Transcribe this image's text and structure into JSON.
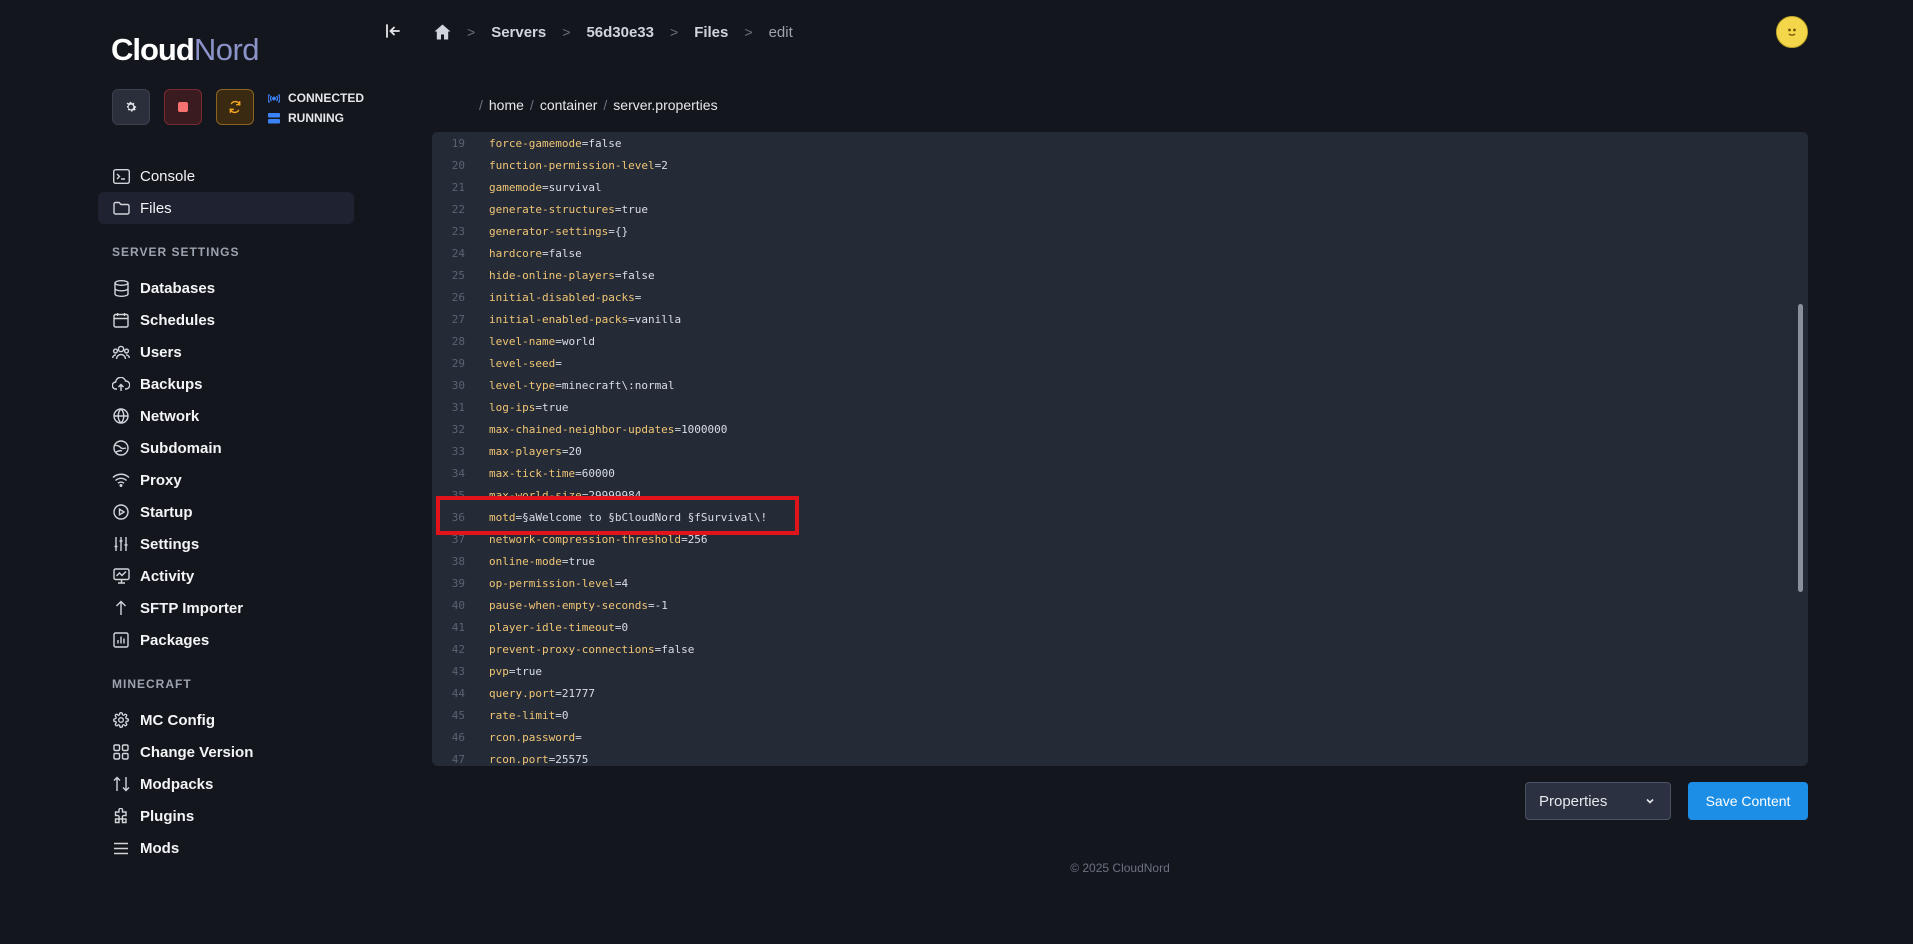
{
  "brand": {
    "part1": "Cloud",
    "part2": "Nord"
  },
  "server_status": {
    "connection": "CONNECTED",
    "state": "RUNNING"
  },
  "nav": {
    "main": [
      {
        "label": "Console",
        "icon": "terminal-icon"
      },
      {
        "label": "Files",
        "icon": "folder-icon",
        "active": true
      }
    ],
    "server_settings_title": "SERVER SETTINGS",
    "server_settings": [
      {
        "label": "Databases",
        "icon": "database-icon"
      },
      {
        "label": "Schedules",
        "icon": "calendar-icon"
      },
      {
        "label": "Users",
        "icon": "users-icon"
      },
      {
        "label": "Backups",
        "icon": "cloud-upload-icon"
      },
      {
        "label": "Network",
        "icon": "globe-icon"
      },
      {
        "label": "Subdomain",
        "icon": "subdomain-globe-icon"
      },
      {
        "label": "Proxy",
        "icon": "wifi-icon"
      },
      {
        "label": "Startup",
        "icon": "play-circle-icon"
      },
      {
        "label": "Settings",
        "icon": "sliders-icon"
      },
      {
        "label": "Activity",
        "icon": "activity-icon"
      },
      {
        "label": "SFTP Importer",
        "icon": "arrow-up-icon"
      },
      {
        "label": "Packages",
        "icon": "bar-chart-icon"
      }
    ],
    "minecraft_title": "MINECRAFT",
    "minecraft": [
      {
        "label": "MC Config",
        "icon": "gear-icon"
      },
      {
        "label": "Change Version",
        "icon": "grid-icon"
      },
      {
        "label": "Modpacks",
        "icon": "arrows-up-down-icon"
      },
      {
        "label": "Plugins",
        "icon": "puzzle-icon"
      },
      {
        "label": "Mods",
        "icon": "list-icon"
      }
    ]
  },
  "breadcrumb": [
    "Servers",
    "56d30e33",
    "Files",
    "edit"
  ],
  "file_path": [
    "home",
    "container",
    "server.properties"
  ],
  "editor": {
    "lines": [
      {
        "n": "19",
        "key": "force-gamemode",
        "value": "false"
      },
      {
        "n": "20",
        "key": "function-permission-level",
        "value": "2"
      },
      {
        "n": "21",
        "key": "gamemode",
        "value": "survival"
      },
      {
        "n": "22",
        "key": "generate-structures",
        "value": "true"
      },
      {
        "n": "23",
        "key": "generator-settings",
        "value": "{}"
      },
      {
        "n": "24",
        "key": "hardcore",
        "value": "false"
      },
      {
        "n": "25",
        "key": "hide-online-players",
        "value": "false"
      },
      {
        "n": "26",
        "key": "initial-disabled-packs",
        "value": ""
      },
      {
        "n": "27",
        "key": "initial-enabled-packs",
        "value": "vanilla"
      },
      {
        "n": "28",
        "key": "level-name",
        "value": "world"
      },
      {
        "n": "29",
        "key": "level-seed",
        "value": ""
      },
      {
        "n": "30",
        "key": "level-type",
        "value": "minecraft\\:normal"
      },
      {
        "n": "31",
        "key": "log-ips",
        "value": "true"
      },
      {
        "n": "32",
        "key": "max-chained-neighbor-updates",
        "value": "1000000"
      },
      {
        "n": "33",
        "key": "max-players",
        "value": "20"
      },
      {
        "n": "34",
        "key": "max-tick-time",
        "value": "60000"
      },
      {
        "n": "35",
        "key": "max-world-size",
        "value": "29999984"
      },
      {
        "n": "36",
        "key": "motd",
        "value": "§aWelcome to §bCloudNord §fSurvival\\!"
      },
      {
        "n": "37",
        "key": "network-compression-threshold",
        "value": "256"
      },
      {
        "n": "38",
        "key": "online-mode",
        "value": "true"
      },
      {
        "n": "39",
        "key": "op-permission-level",
        "value": "4"
      },
      {
        "n": "40",
        "key": "pause-when-empty-seconds",
        "value": "-1"
      },
      {
        "n": "41",
        "key": "player-idle-timeout",
        "value": "0"
      },
      {
        "n": "42",
        "key": "prevent-proxy-connections",
        "value": "false"
      },
      {
        "n": "43",
        "key": "pvp",
        "value": "true"
      },
      {
        "n": "44",
        "key": "query.port",
        "value": "21777"
      },
      {
        "n": "45",
        "key": "rate-limit",
        "value": "0"
      },
      {
        "n": "46",
        "key": "rcon.password",
        "value": ""
      },
      {
        "n": "47",
        "key": "rcon.port",
        "value": "25575"
      }
    ]
  },
  "mode_select": {
    "value": "Properties"
  },
  "save_label": "Save Content",
  "footer": "© 2025 CloudNord",
  "colors": {
    "accent": "#1c8ee6",
    "highlight": "#e1141b",
    "key": "#f0c674"
  }
}
